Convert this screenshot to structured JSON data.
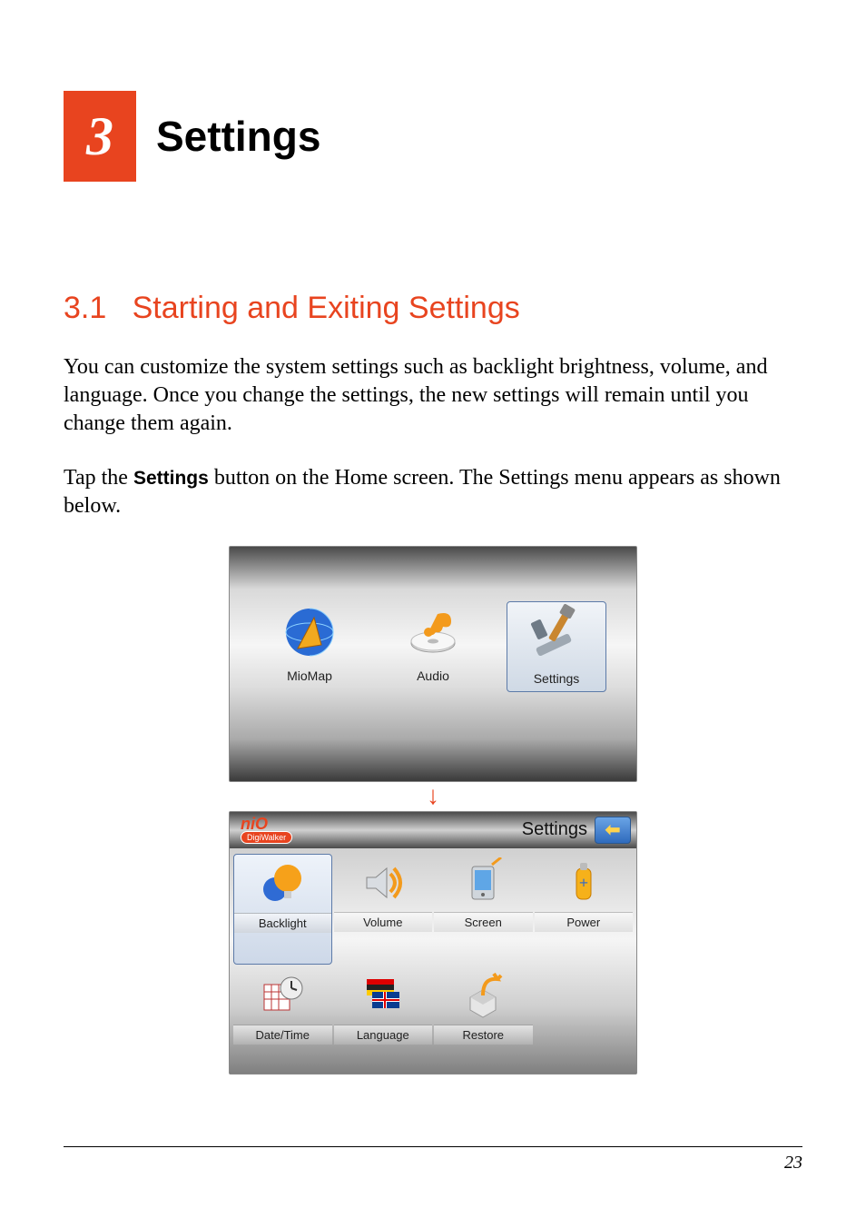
{
  "chapter": {
    "number": "3",
    "title": "Settings"
  },
  "section": {
    "number": "3.1",
    "title": "Starting and Exiting Settings"
  },
  "paragraphs": {
    "p1": "You can customize the system settings such as backlight brightness, volume, and language. Once you change the settings, the new settings will remain until you change them again.",
    "p2_a": "Tap the ",
    "p2_bold": "Settings",
    "p2_b": " button on the Home screen. The Settings menu appears as shown below."
  },
  "home_screen": {
    "items": [
      {
        "label": "MioMap",
        "icon": "globe-icon"
      },
      {
        "label": "Audio",
        "icon": "music-cd-icon"
      },
      {
        "label": "Settings",
        "icon": "tools-icon",
        "selected": true
      }
    ]
  },
  "arrow": "↓",
  "settings_screen": {
    "logo": {
      "brand": "niO",
      "sub": "DigiWalker"
    },
    "title": "Settings",
    "back_glyph": "⬅",
    "row1": [
      {
        "label": "Backlight",
        "icon": "bulb-icon",
        "selected": true
      },
      {
        "label": "Volume",
        "icon": "speaker-icon"
      },
      {
        "label": "Screen",
        "icon": "pda-icon"
      },
      {
        "label": "Power",
        "icon": "battery-icon"
      }
    ],
    "row2": [
      {
        "label": "Date/Time",
        "icon": "calendar-clock-icon"
      },
      {
        "label": "Language",
        "icon": "flags-icon"
      },
      {
        "label": "Restore",
        "icon": "box-arrow-icon"
      }
    ]
  },
  "page_number": "23"
}
